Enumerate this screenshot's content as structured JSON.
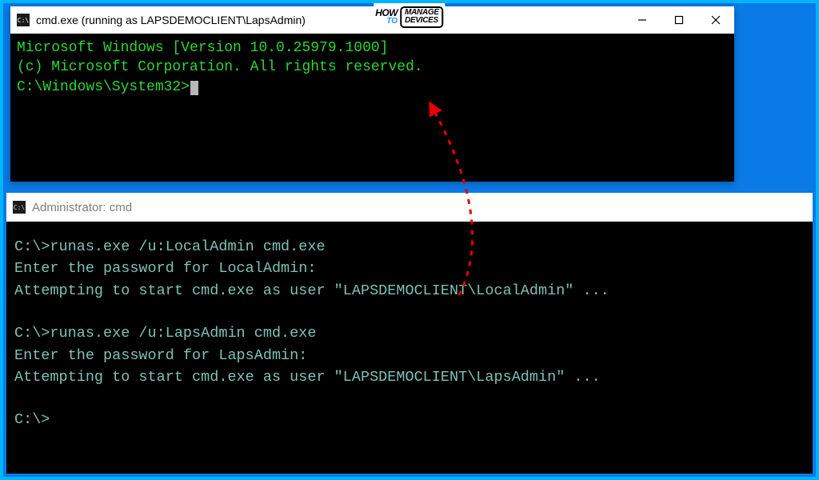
{
  "watermark": {
    "how": "HOW",
    "to": "TO",
    "line1": "MANAGE",
    "line2": "DEVICES"
  },
  "upper": {
    "title": "cmd.exe (running as LAPSDEMOCLIENT\\LapsAdmin)",
    "lines": {
      "l1": "Microsoft Windows [Version 10.0.25979.1000]",
      "l2": "(c) Microsoft Corporation. All rights reserved.",
      "l3": "",
      "l4": "C:\\Windows\\System32>"
    }
  },
  "lower": {
    "title": "Administrator: cmd",
    "lines": {
      "l1": "C:\\>runas.exe /u:LocalAdmin cmd.exe",
      "l2": "Enter the password for LocalAdmin:",
      "l3": "Attempting to start cmd.exe as user \"LAPSDEMOCLIENT\\LocalAdmin\" ...",
      "l4": "C:\\>runas.exe /u:LapsAdmin cmd.exe",
      "l5": "Enter the password for LapsAdmin:",
      "l6": "Attempting to start cmd.exe as user \"LAPSDEMOCLIENT\\LapsAdmin\" ...",
      "l7": "C:\\>"
    }
  }
}
